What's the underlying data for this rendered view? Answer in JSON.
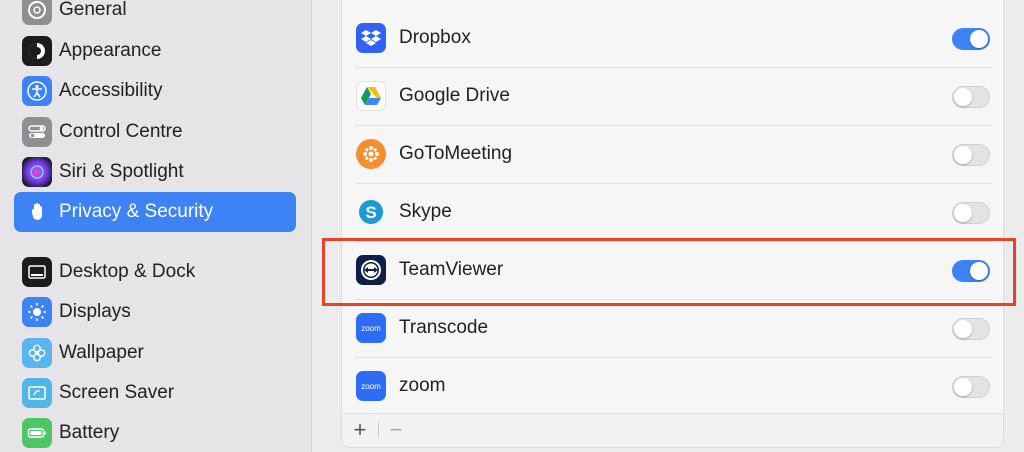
{
  "sidebar": {
    "items": [
      {
        "label": "General",
        "icon": "gear-icon"
      },
      {
        "label": "Appearance",
        "icon": "appearance-icon"
      },
      {
        "label": "Accessibility",
        "icon": "accessibility-icon"
      },
      {
        "label": "Control Centre",
        "icon": "control-centre-icon"
      },
      {
        "label": "Siri & Spotlight",
        "icon": "siri-icon"
      },
      {
        "label": "Privacy & Security",
        "icon": "hand-icon",
        "selected": true
      },
      {
        "label": "Desktop & Dock",
        "icon": "dock-icon"
      },
      {
        "label": "Displays",
        "icon": "sun-icon"
      },
      {
        "label": "Wallpaper",
        "icon": "flower-icon"
      },
      {
        "label": "Screen Saver",
        "icon": "screen-saver-icon"
      },
      {
        "label": "Battery",
        "icon": "battery-icon"
      }
    ]
  },
  "apps": [
    {
      "name": "Dropbox",
      "icon": "dropbox-icon",
      "enabled": true
    },
    {
      "name": "Google Drive",
      "icon": "google-drive-icon",
      "enabled": false
    },
    {
      "name": "GoToMeeting",
      "icon": "gotomeeting-icon",
      "enabled": false
    },
    {
      "name": "Skype",
      "icon": "skype-icon",
      "enabled": false
    },
    {
      "name": "TeamViewer",
      "icon": "teamviewer-icon",
      "enabled": true
    },
    {
      "name": "Transcode",
      "icon": "zoom-icon",
      "enabled": false,
      "icon_text": "zoom"
    },
    {
      "name": "zoom",
      "icon": "zoom-icon",
      "enabled": false,
      "icon_text": "zoom"
    }
  ],
  "bottom_bar": {
    "add_label": "+",
    "remove_label": "−"
  },
  "colors": {
    "accent": "#3d83f6",
    "highlight": "#e8442c"
  }
}
